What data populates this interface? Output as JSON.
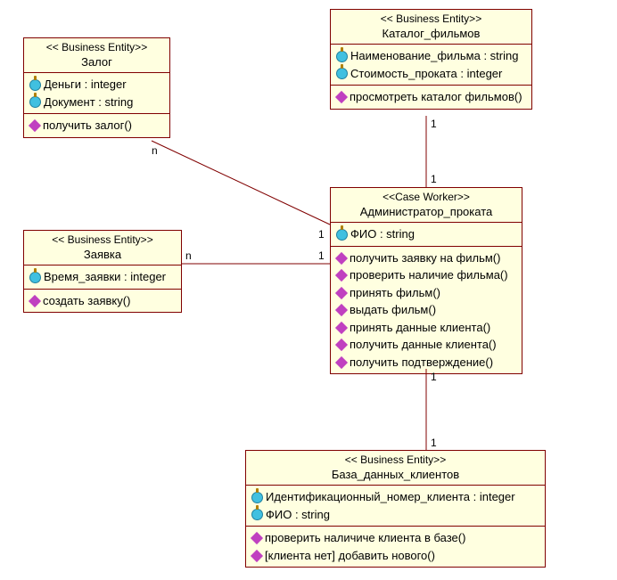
{
  "zalog": {
    "stereotype": "<< Business Entity>>",
    "name": "Залог",
    "attrs": [
      "Деньги : integer",
      "Документ : string"
    ],
    "ops": [
      "получить залог()"
    ]
  },
  "catalog": {
    "stereotype": "<< Business Entity>>",
    "name": "Каталог_фильмов",
    "attrs": [
      "Наименование_фильма : string",
      "Стоимость_проката : integer"
    ],
    "ops": [
      "просмотреть каталог фильмов()"
    ]
  },
  "zayavka": {
    "stereotype": "<< Business Entity>>",
    "name": "Заявка",
    "attrs": [
      "Время_заявки : integer"
    ],
    "ops": [
      "создать заявку()"
    ]
  },
  "admin": {
    "stereotype": "<<Case Worker>>",
    "name": "Администратор_проката",
    "attrs": [
      "ФИО : string"
    ],
    "ops": [
      "получить заявку на фильм()",
      "проверить наличие фильма()",
      "принять фильм()",
      "выдать фильм()",
      "принять данные клиента()",
      "получить данные клиента()",
      "получить подтверждение()"
    ]
  },
  "db": {
    "stereotype": "<< Business Entity>>",
    "name": "База_данных_клиентов",
    "attrs": [
      "Идентификационный_номер_клиента : integer",
      "ФИО : string"
    ],
    "ops": [
      "проверить наличиче клиента в базе()",
      "[клиента нет] добавить нового()"
    ]
  },
  "mult": {
    "a_n": "n",
    "a_1": "1",
    "b_1t": "1",
    "b_1b": "1",
    "c_n": "n",
    "c_1": "1",
    "d_1t": "1",
    "d_1b": "1"
  }
}
